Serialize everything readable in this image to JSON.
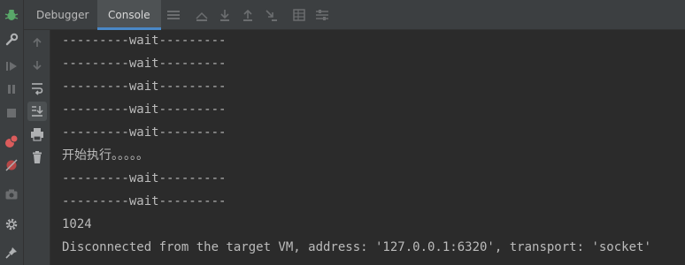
{
  "tabs": [
    {
      "label": "Debugger",
      "active": false
    },
    {
      "label": "Console",
      "active": true
    }
  ],
  "toolbar_icons": [
    "menu-icon",
    "show-execution-point-icon",
    "step-over-icon",
    "step-into-icon",
    "step-out-icon",
    "run-to-cursor-icon",
    "evaluate-expression-icon",
    "trace-icon"
  ],
  "left_tools": [
    "debug-bug-icon",
    "wrench-icon",
    "resume-icon",
    "pause-icon",
    "stop-icon",
    "view-breakpoints-icon",
    "mute-breakpoints-icon",
    "camera-icon",
    "settings-icon",
    "pin-icon"
  ],
  "console_tools": [
    "up-arrow-icon",
    "down-arrow-icon",
    "soft-wrap-icon",
    "scroll-to-end-icon",
    "print-icon",
    "trash-icon"
  ],
  "console": {
    "lines": [
      "---------wait---------",
      "---------wait---------",
      "---------wait---------",
      "---------wait---------",
      "---------wait---------",
      "开始执行。。。。。",
      "---------wait---------",
      "---------wait---------",
      "1024",
      "Disconnected from the target VM, address: '127.0.0.1:6320', transport: 'socket'"
    ]
  },
  "colors": {
    "background": "#2b2b2b",
    "panel": "#3c3f41",
    "text": "#bbbbbb",
    "accent": "#4a88c7",
    "debug_green": "#59a869",
    "breakpoint_red": "#db5c5c"
  }
}
